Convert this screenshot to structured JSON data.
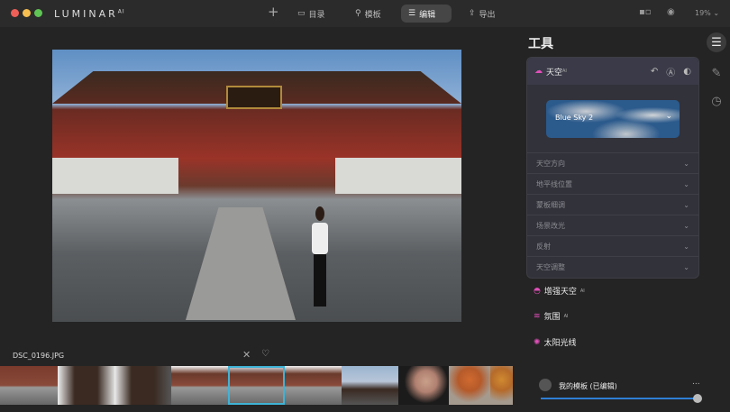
{
  "app": {
    "logo": "LUMINAR",
    "logo_sup": "AI"
  },
  "nav": [
    {
      "label": "目录",
      "icon": "folder-icon"
    },
    {
      "label": "模板",
      "icon": "wand-icon"
    },
    {
      "label": "编辑",
      "icon": "sliders-icon"
    },
    {
      "label": "导出",
      "icon": "share-icon"
    }
  ],
  "zoom": "19%",
  "colors": {
    "close": "#ee5f58",
    "minimize": "#f6be4f",
    "maximize": "#5fc454",
    "accent": "#3fb3d6",
    "slider": "#2f7fd6",
    "tool_pink": "#e04fb8"
  },
  "tools": {
    "title": "工具",
    "sky": {
      "name": "天空",
      "badge": "AI",
      "preset": "Blue Sky 2",
      "sections": [
        "天空方向",
        "地平线位置",
        "蒙板细调",
        "场景改光",
        "反射",
        "天空调整"
      ]
    },
    "others": [
      {
        "name": "增强天空",
        "badge": "AI"
      },
      {
        "name": "氛围",
        "badge": "AI"
      },
      {
        "name": "太阳光线",
        "badge": ""
      }
    ]
  },
  "template": {
    "name": "我的模板 (已编辑)",
    "more": "...",
    "amount": 1.0
  },
  "filmstrip": {
    "filename": "DSC_0196.JPG",
    "selected_index": 4
  }
}
